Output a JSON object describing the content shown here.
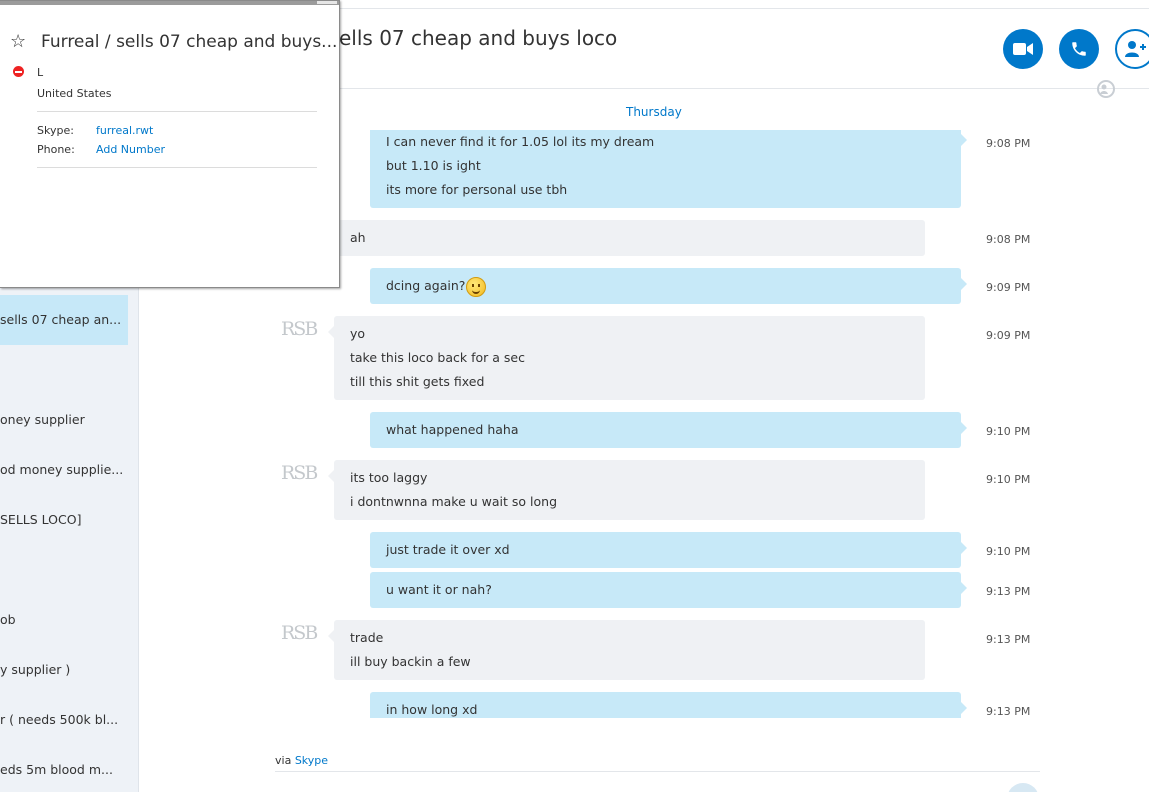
{
  "sidebar": {
    "items": [
      {
        "label": "sells 07 cheap an...",
        "active": true
      },
      {
        "label": "oney supplier"
      },
      {
        "label": "od money supplie..."
      },
      {
        "label": "SELLS LOCO]"
      },
      {
        "label": "ob"
      },
      {
        "label": "y supplier )"
      },
      {
        "label": "r ( needs 500k bl..."
      },
      {
        "label": "eds 5m blood m..."
      }
    ]
  },
  "conversation": {
    "title": "ells 07 cheap and buys loco",
    "day": "Thursday"
  },
  "header_buttons": {
    "video": "video-call-icon",
    "call": "phone-call-icon",
    "add": "add-people-icon"
  },
  "messages": [
    {
      "dir": "out",
      "lines": [
        "I can never find it for 1.05 lol its my dream",
        "but 1.10 is ight",
        "its more for personal use tbh"
      ],
      "time": "9:08 PM"
    },
    {
      "dir": "in",
      "lines": [
        "ah"
      ],
      "time": "9:08 PM"
    },
    {
      "dir": "out",
      "lines": [
        "dcing again?"
      ],
      "emoji": "smile-emoticon",
      "time": "9:09 PM"
    },
    {
      "dir": "in",
      "avatar": "RSB",
      "lines": [
        "yo",
        "take this loco back for a sec",
        "till this shit gets fixed"
      ],
      "time": "9:09 PM"
    },
    {
      "dir": "out",
      "lines": [
        "what happened haha"
      ],
      "time": "9:10 PM"
    },
    {
      "dir": "in",
      "avatar": "RSB",
      "lines": [
        "its too laggy",
        "i dontnwnna make u wait so long"
      ],
      "time": "9:10 PM"
    },
    {
      "dir": "out",
      "lines": [
        "just trade it over xd"
      ],
      "time": "9:10 PM"
    },
    {
      "dir": "out",
      "lines": [
        "u want it or nah?"
      ],
      "time": "9:13 PM"
    },
    {
      "dir": "in",
      "avatar": "RSB",
      "lines": [
        "trade",
        "ill buy backin a few"
      ],
      "time": "9:13 PM"
    },
    {
      "dir": "out",
      "lines": [
        "in how long xd"
      ],
      "time": "9:13 PM"
    }
  ],
  "footer": {
    "via": "via",
    "via_link": "Skype"
  },
  "profile_popup": {
    "title": "Furreal / sells 07 cheap and buys...",
    "name": "L",
    "location": "United States",
    "skype_label": "Skype:",
    "skype_value": "furreal.rwt",
    "phone_label": "Phone:",
    "phone_value": "Add Number"
  },
  "colors": {
    "accent": "#0078ca",
    "outgoing_bubble": "#c7e9f8",
    "incoming_bubble": "#eff1f4",
    "sidebar_bg": "#eef2f7",
    "sidebar_active": "#c6e8f8",
    "status_busy": "#e22222"
  }
}
